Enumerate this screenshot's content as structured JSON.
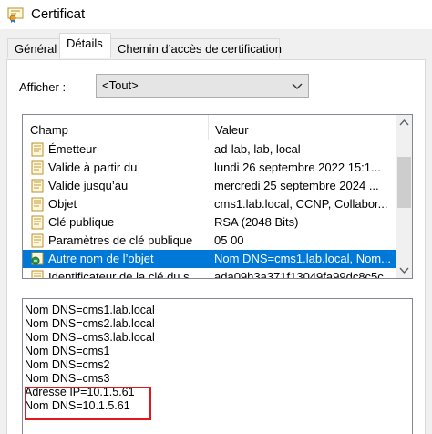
{
  "window": {
    "title": "Certificat",
    "icon": "certificate-icon"
  },
  "tabs": [
    {
      "label": "Général",
      "active": false
    },
    {
      "label": "Détails",
      "active": true
    },
    {
      "label": "Chemin d’accès de certification",
      "active": false
    }
  ],
  "show": {
    "label": "Afficher :",
    "selected": "<Tout>"
  },
  "list": {
    "columns": {
      "field": "Champ",
      "value": "Valeur"
    },
    "rows": [
      {
        "field": "Émetteur",
        "value": "ad-lab, lab, local",
        "icon": "certificate-field-icon"
      },
      {
        "field": "Valide à partir du",
        "value": "lundi 26 septembre 2022 15:1...",
        "icon": "certificate-field-icon"
      },
      {
        "field": "Valide jusqu’au",
        "value": "mercredi 25 septembre 2024 ...",
        "icon": "certificate-field-icon"
      },
      {
        "field": "Objet",
        "value": "cms1.lab.local, CCNP, Collabor...",
        "icon": "certificate-field-icon"
      },
      {
        "field": "Clé publique",
        "value": "RSA (2048 Bits)",
        "icon": "certificate-field-icon"
      },
      {
        "field": "Paramètres de clé publique",
        "value": "05 00",
        "icon": "certificate-field-icon"
      },
      {
        "field": "Autre nom de l’objet",
        "value": "Nom DNS=cms1.lab.local, Nom...",
        "icon": "extension-icon",
        "selected": true
      },
      {
        "field": "Identificateur de la clé du s...",
        "value": "ada09h3a371f13049fa99dc8c5c...",
        "icon": "certificate-field-icon"
      }
    ]
  },
  "detail": {
    "lines": [
      "Nom DNS=cms1.lab.local",
      "Nom DNS=cms2.lab.local",
      "Nom DNS=cms3.lab.local",
      "Nom DNS=cms1",
      "Nom DNS=cms2",
      "Nom DNS=cms3",
      "Adresse IP=10.1.5.61",
      "Nom DNS=10.1.5.61"
    ],
    "highlight_color": "#e0181c"
  },
  "colors": {
    "selection": "#0078d7",
    "background": "#f0f0f0"
  }
}
